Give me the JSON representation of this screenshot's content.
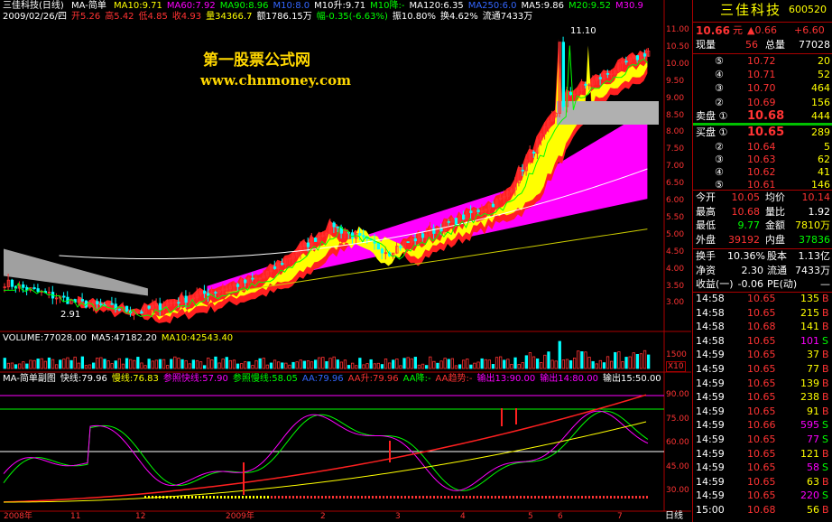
{
  "window": {
    "title": "三佳科技(日线)",
    "indicator": "MA-简单"
  },
  "ma_header": {
    "items": [
      {
        "label": "MA10:9.71",
        "color": "#ffff00"
      },
      {
        "label": "MA60:7.92",
        "color": "#ff00ff"
      },
      {
        "label": "MA90:8.96",
        "color": "#00ff00"
      },
      {
        "label": "M10:8.0",
        "color": "#3366ff"
      },
      {
        "label": "M10升:9.71",
        "color": "#ffffff"
      },
      {
        "label": "M10降:-",
        "color": "#00ff00"
      },
      {
        "label": "MA120:6.35",
        "color": "#ffffff"
      },
      {
        "label": "MA250:6.0",
        "color": "#3366ff"
      },
      {
        "label": "MA5:9.86",
        "color": "#ffffff"
      },
      {
        "label": "M20:9.52",
        "color": "#00ff00"
      },
      {
        "label": "M30.9",
        "color": "#ff00ff"
      }
    ]
  },
  "price_header": {
    "date": "2009/02/26/四",
    "open": "开5.26",
    "high": "高5.42",
    "low": "低4.85",
    "close": "收4.93",
    "volume": "量34366.7",
    "amount": "额1786.15万",
    "change": "幅-0.35(-6.63%)",
    "amplitude": "振10.80%",
    "turnover": "换4.62%",
    "float": "流通7433万"
  },
  "watermark": {
    "line1": "第一股票公式网",
    "line2": "www.chnmoney.com"
  },
  "price_axis": [
    "11.00",
    "10.50",
    "10.00",
    "9.50",
    "9.00",
    "8.50",
    "8.00",
    "7.50",
    "7.00",
    "6.50",
    "6.00",
    "5.50",
    "5.00",
    "4.50",
    "4.00",
    "3.50",
    "3.00"
  ],
  "price_annotations": {
    "high": "11.10",
    "low": "2.91"
  },
  "volume_header": {
    "items": [
      {
        "label": "VOLUME:77028.00",
        "color": "#ffffff"
      },
      {
        "label": "MA5:47182.20",
        "color": "#ffffff"
      },
      {
        "label": "MA10:42543.40",
        "color": "#ffff00"
      }
    ]
  },
  "volume_axis": {
    "top": "1500",
    "unit": "X10"
  },
  "sub_header": {
    "items": [
      {
        "label": "MA-简单副图",
        "color": "#ffffff"
      },
      {
        "label": "快线:79.96",
        "color": "#ffffff"
      },
      {
        "label": "慢线:76.83",
        "color": "#ffff00"
      },
      {
        "label": "参照快线:57.90",
        "color": "#ff00ff"
      },
      {
        "label": "参照慢线:58.05",
        "color": "#00ff00"
      },
      {
        "label": "AA:79.96",
        "color": "#3366ff"
      },
      {
        "label": "AA升:79.96",
        "color": "#ff3333"
      },
      {
        "label": "AA降:-",
        "color": "#00ff00"
      },
      {
        "label": "AA趋势:-",
        "color": "#ff3333"
      },
      {
        "label": "输出13:90.00",
        "color": "#ff00ff"
      },
      {
        "label": "输出14:80.00",
        "color": "#ff00ff"
      },
      {
        "label": "输出15:50.00",
        "color": "#ffffff"
      }
    ]
  },
  "sub_axis": [
    "90.00",
    "75.00",
    "60.00",
    "45.00",
    "30.00"
  ],
  "x_axis": {
    "labels": [
      "2008年",
      "11",
      "12",
      "2009年",
      "2",
      "3",
      "4",
      "5",
      "6",
      "7"
    ],
    "tab": "日线"
  },
  "quote": {
    "name": "三佳科技",
    "code": "600520",
    "price": "10.66",
    "price_unit": "元",
    "change": "▲0.66",
    "change_pct": "+6.60",
    "cur_vol_label": "现量",
    "cur_vol": "56",
    "total_vol_label": "总量",
    "total_vol": "77028",
    "sells": [
      {
        "label": "⑤",
        "price": "10.72",
        "vol": "20"
      },
      {
        "label": "④",
        "price": "10.71",
        "vol": "52"
      },
      {
        "label": "③",
        "price": "10.70",
        "vol": "464"
      },
      {
        "label": "②",
        "price": "10.69",
        "vol": "156"
      }
    ],
    "sell1": {
      "label": "卖盘 ①",
      "price": "10.68",
      "vol": "444"
    },
    "buy1": {
      "label": "买盘 ①",
      "price": "10.65",
      "vol": "289"
    },
    "buys": [
      {
        "label": "②",
        "price": "10.64",
        "vol": "5"
      },
      {
        "label": "③",
        "price": "10.63",
        "vol": "62"
      },
      {
        "label": "④",
        "price": "10.62",
        "vol": "41"
      },
      {
        "label": "⑤",
        "price": "10.61",
        "vol": "146"
      }
    ],
    "stats": [
      {
        "l1": "今开",
        "v1": "10.05",
        "l2": "均价",
        "v2": "10.14",
        "c1": "#ff3333",
        "c2": "#ff3333"
      },
      {
        "l1": "最高",
        "v1": "10.68",
        "l2": "量比",
        "v2": "1.92",
        "c1": "#ff3333",
        "c2": "#ffffff"
      },
      {
        "l1": "最低",
        "v1": "9.77",
        "l2": "金额",
        "v2": "7810万",
        "c1": "#00ff00",
        "c2": "#ffff00"
      },
      {
        "l1": "外盘",
        "v1": "39192",
        "l2": "内盘",
        "v2": "37836",
        "c1": "#ff3333",
        "c2": "#00ff00"
      }
    ],
    "stats2": [
      {
        "l1": "换手",
        "v1": "10.36%",
        "l2": "股本",
        "v2": "1.13亿"
      },
      {
        "l1": "净资",
        "v1": "2.30",
        "l2": "流通",
        "v2": "7433万"
      },
      {
        "l1": "收益(一)",
        "v1": "-0.06",
        "l2": "PE(动)",
        "v2": "—"
      }
    ],
    "ticks": [
      {
        "t": "14:58",
        "p": "10.65",
        "v": "135",
        "d": "B"
      },
      {
        "t": "14:58",
        "p": "10.65",
        "v": "215",
        "d": "B"
      },
      {
        "t": "14:58",
        "p": "10.68",
        "v": "141",
        "d": "B"
      },
      {
        "t": "14:58",
        "p": "10.65",
        "v": "101",
        "d": "S"
      },
      {
        "t": "14:59",
        "p": "10.65",
        "v": "37",
        "d": "B"
      },
      {
        "t": "14:59",
        "p": "10.65",
        "v": "77",
        "d": "B"
      },
      {
        "t": "14:59",
        "p": "10.65",
        "v": "139",
        "d": "B"
      },
      {
        "t": "14:59",
        "p": "10.65",
        "v": "238",
        "d": "B"
      },
      {
        "t": "14:59",
        "p": "10.65",
        "v": "91",
        "d": "B"
      },
      {
        "t": "14:59",
        "p": "10.66",
        "v": "595",
        "d": "S"
      },
      {
        "t": "14:59",
        "p": "10.65",
        "v": "77",
        "d": "S"
      },
      {
        "t": "14:59",
        "p": "10.65",
        "v": "121",
        "d": "B"
      },
      {
        "t": "14:59",
        "p": "10.65",
        "v": "58",
        "d": "S"
      },
      {
        "t": "14:59",
        "p": "10.65",
        "v": "63",
        "d": "B"
      },
      {
        "t": "14:59",
        "p": "10.65",
        "v": "220",
        "d": "S"
      },
      {
        "t": "15:00",
        "p": "10.68",
        "v": "56",
        "d": "B"
      }
    ]
  }
}
